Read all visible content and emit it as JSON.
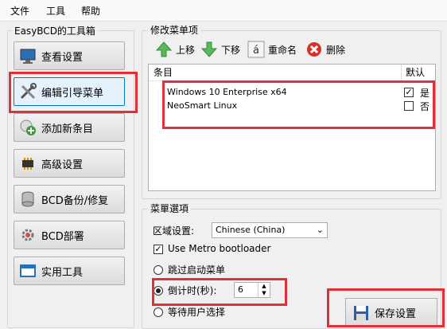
{
  "menubar": {
    "file": "文件",
    "tools": "工具",
    "help": "帮助"
  },
  "left_panel": {
    "title": "EasyBCD的工具箱",
    "buttons": [
      {
        "label": "查看设置",
        "icon": "monitor-icon"
      },
      {
        "label": "编辑引导菜单",
        "icon": "tools-icon"
      },
      {
        "label": "添加新条目",
        "icon": "add-entry-icon"
      },
      {
        "label": "高级设置",
        "icon": "chip-icon"
      },
      {
        "label": "BCD备份/修复",
        "icon": "database-icon"
      },
      {
        "label": "BCD部署",
        "icon": "gear-icon"
      },
      {
        "label": "实用工具",
        "icon": "window-icon"
      }
    ]
  },
  "modify_group": {
    "title": "修改菜单项",
    "toolbar": {
      "up": "上移",
      "down": "下移",
      "rename": "重命名",
      "delete": "删除"
    },
    "columns": {
      "entry": "条目",
      "default": "默认"
    },
    "entries": [
      {
        "name": "Windows 10 Enterprise x64",
        "default_label": "是",
        "checked": true
      },
      {
        "name": "NeoSmart Linux",
        "default_label": "否",
        "checked": false
      }
    ]
  },
  "options_group": {
    "title": "菜單選項",
    "region_label": "区域设置:",
    "region_value": "Chinese (China)",
    "metro_label": "Use Metro bootloader",
    "skip_label": "跳过启动菜单",
    "countdown_label": "倒计时(秒):",
    "countdown_value": "6",
    "wait_label": "等待用户选择",
    "save_button": "保存设置"
  },
  "colors": {
    "highlight": "#e0313a",
    "accent": "#0078d7"
  }
}
